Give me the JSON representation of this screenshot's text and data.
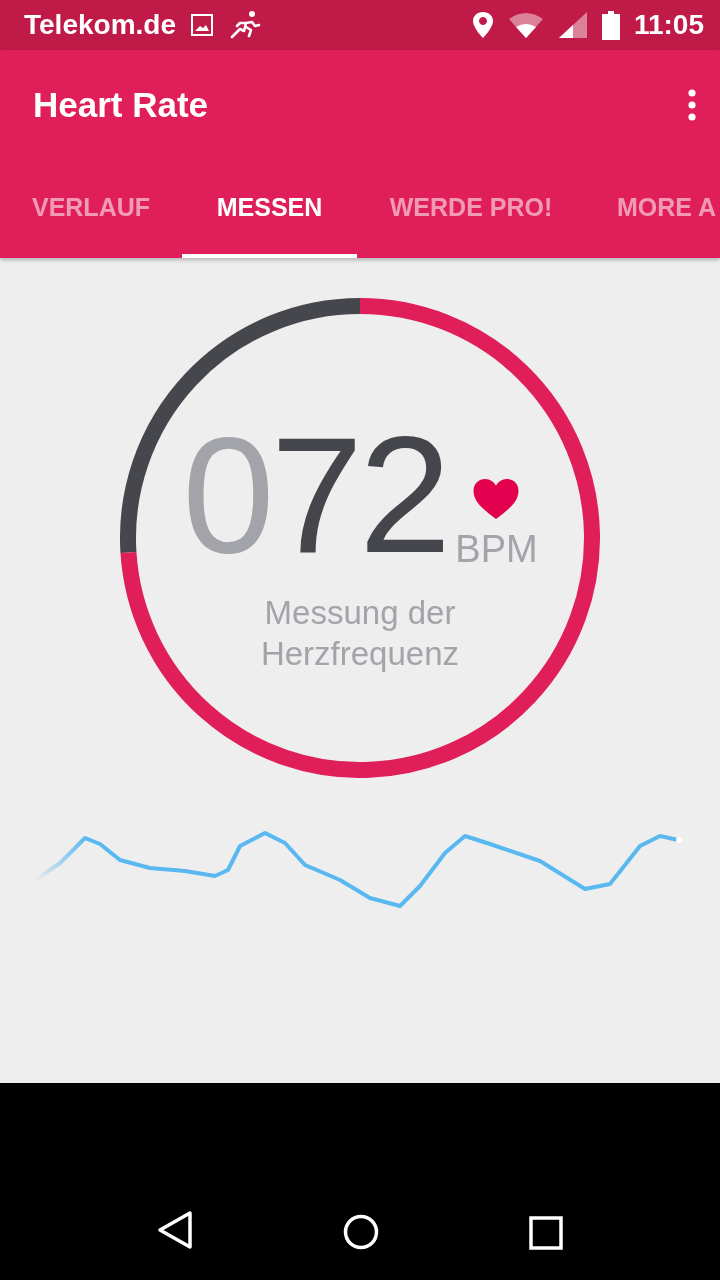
{
  "status_bar": {
    "carrier": "Telekom.de",
    "time": "11:05"
  },
  "app_bar": {
    "title": "Heart Rate"
  },
  "tabs": [
    {
      "label": "VERLAUF",
      "selected": false
    },
    {
      "label": "MESSEN",
      "selected": true
    },
    {
      "label": "WERDE PRO!",
      "selected": false
    },
    {
      "label": "MORE A",
      "selected": false
    }
  ],
  "measurement": {
    "leading_zeros": "0",
    "value": "72",
    "unit": "BPM",
    "caption": "Messung der Herzfrequenz"
  }
}
